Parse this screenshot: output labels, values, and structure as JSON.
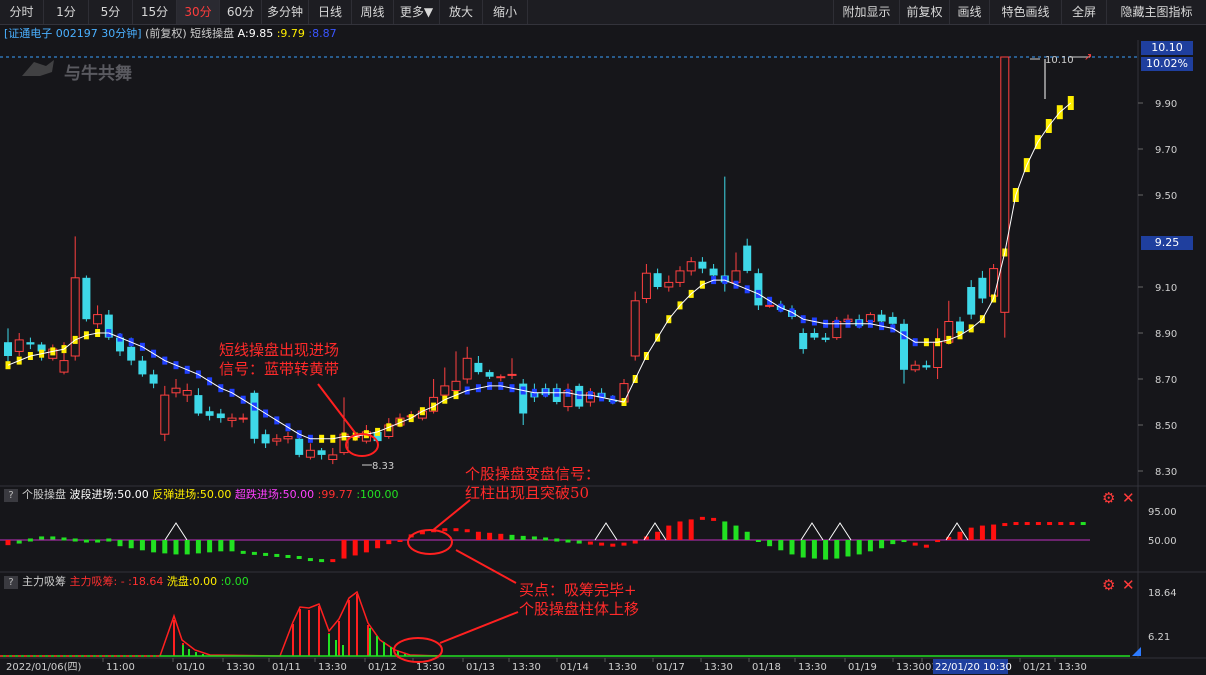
{
  "toolbar": {
    "left": [
      "分时",
      "1分",
      "5分",
      "15分",
      "30分",
      "60分",
      "多分钟",
      "日线",
      "周线",
      "更多▼",
      "放大",
      "缩小"
    ],
    "active": "30分",
    "right": [
      "附加显示",
      "前复权",
      "画线",
      "特色画线",
      "全屏",
      "隐藏主图指标"
    ]
  },
  "info": {
    "stock": "[证通电子",
    "code": "002197 30分钟]",
    "adjust": "(前复权)",
    "indicator": "短线操盘",
    "a_label": "A:9.85",
    "v1": ":9.79",
    "v2": ":8.87"
  },
  "price_axis": {
    "labels": [
      "10.10",
      "10.02%",
      "9.90",
      "9.70",
      "9.50",
      "9.25",
      "9.10",
      "8.90",
      "8.70",
      "8.50",
      "8.30"
    ],
    "current": "10.10",
    "current_pct": "10.02%",
    "marker": "9.25",
    "min": 8.25,
    "max": 10.1
  },
  "chart_labels": {
    "high": "10.10",
    "low": "8.33"
  },
  "logo": {
    "text": "与牛共舞"
  },
  "panel1": {
    "q": "?",
    "name": "个股操盘",
    "wave": "波段进场:50.00",
    "rebound": "反弹进场:50.00",
    "oversold": "超跌进场:50.00",
    "v1": ":99.77",
    "v2": ":100.00",
    "axis": [
      "95.00",
      "50.00"
    ]
  },
  "panel2": {
    "q": "?",
    "name": "主力吸筹",
    "absorb": "主力吸筹: -",
    "absorb_val": ":18.64",
    "wash": "洗盘:0.00",
    "wash2": ":0.00",
    "axis": [
      "18.64",
      "6.21"
    ]
  },
  "time_axis": [
    "2022/01/06(四)",
    "11:00",
    "01/10",
    "13:30",
    "01/11",
    "13:30",
    "01/12",
    "13:30",
    "01/13",
    "13:30",
    "01/14",
    "13:30",
    "01/17",
    "13:30",
    "01/18",
    "13:30",
    "01/19",
    "13:30",
    "01",
    "22/01/20 10:30",
    "01/21",
    "13:30"
  ],
  "annotations": {
    "a1_line1": "短线操盘出现进场",
    "a1_line2": "信号：蓝带转黄带",
    "a2_line1": "个股操盘变盘信号：",
    "a2_line2": "红柱出现且突破50",
    "a3_line1": "买点：吸筹完毕+",
    "a3_line2": "个股操盘柱体上移"
  },
  "colors": {
    "up": "#ff4040",
    "down": "#3ed8e8",
    "yellow": "#ffee00",
    "blue": "#2040ff",
    "green": "#22e022",
    "red": "#ff1010",
    "magenta": "#c030c0",
    "annotation": "#ff2a2a"
  }
}
